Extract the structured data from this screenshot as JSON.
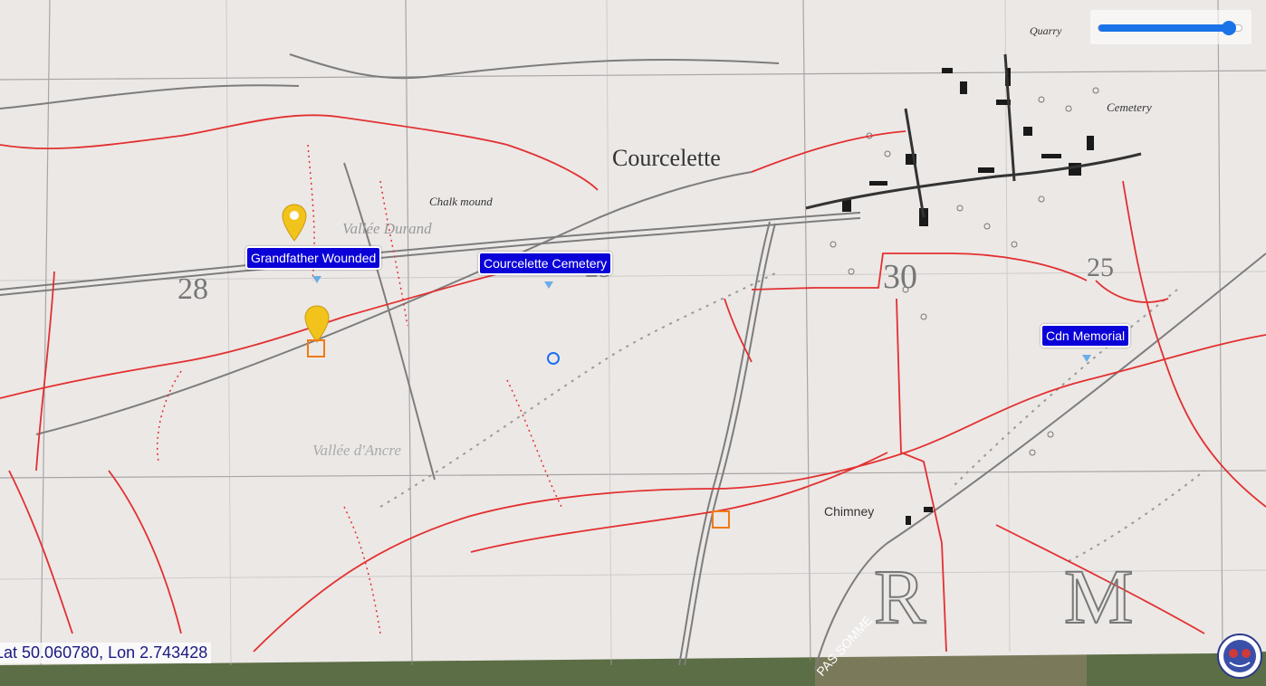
{
  "map": {
    "place_names": [
      {
        "text": "Courcelette"
      },
      {
        "text": "Chalk mound"
      },
      {
        "text": "Vallée Durand"
      },
      {
        "text": "Vallée d'Ancre"
      },
      {
        "text": "Chimney"
      },
      {
        "text": "Quarry"
      },
      {
        "text": "Cemetery"
      },
      {
        "text": "28"
      },
      {
        "text": "29"
      },
      {
        "text": "30"
      },
      {
        "text": "25"
      },
      {
        "text": "R"
      },
      {
        "text": "M"
      }
    ],
    "markers": [
      {
        "label": "Grandfather Wounded",
        "type": "label"
      },
      {
        "label": "Courcelette Cemetery",
        "type": "label"
      },
      {
        "label": "Cdn Memorial",
        "type": "label"
      }
    ],
    "colors": {
      "label_bg": "#0a00d8",
      "trench": "#e23030",
      "pin": "#f2c31b",
      "square": "#f07a12",
      "circle": "#1e6ff0"
    }
  },
  "opacity_slider": {
    "value_fraction": 0.9
  },
  "coordinate_readout": "Lat 50.060780, Lon 2.743428",
  "road_label": "PAS SOMME",
  "icons": {
    "pin": "map-pin-icon",
    "logo": "emblem-icon"
  }
}
